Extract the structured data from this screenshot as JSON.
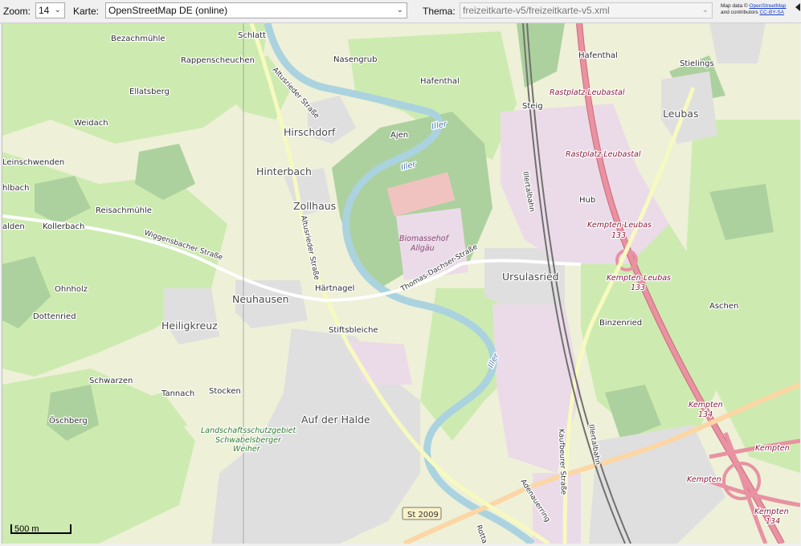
{
  "toolbar": {
    "zoom_label": "Zoom:",
    "zoom_value": "14",
    "map_label": "Karte:",
    "map_value": "OpenStreetMap DE (online)",
    "theme_label": "Thema:",
    "theme_value": "freizeitkarte-v5/freizeitkarte-v5.xml",
    "attribution_prefix": "Map data ©",
    "attribution_link": "OpenStreetMap",
    "attribution_mid": "and contributors",
    "attribution_license": "CC-BY-SA"
  },
  "map": {
    "scale_label": "500 m",
    "places_large": [
      "Hirschdorf",
      "Hinterbach",
      "Zollhaus",
      "Neuhausen",
      "Heiligkreuz",
      "Auf der Halde",
      "Ursulasried",
      "Leubas"
    ],
    "places_small": [
      "Schlatt",
      "Bezachmühle",
      "Rappenscheuchen",
      "Nasengrub",
      "Hafenthal",
      "Hafenthal",
      "Stielings",
      "Ellatsberg",
      "Weidach",
      "Steig",
      "Ajen",
      "Leinschwenden",
      "hlbach",
      "Reisachmühle",
      "alden",
      "Kollerbach",
      "Ohnholz",
      "Härtnagel",
      "Dottenried",
      "Stiftsbleiche",
      "Hub",
      "Binzenried",
      "Aschen",
      "Schwarzen",
      "Tannach",
      "Stocken",
      "Öschberg"
    ],
    "streets": [
      "Altusrieder Straße",
      "Altusrieder Straße",
      "Wiggensbacher Straße",
      "Thomas-Dachser-Straße",
      "Illertalbahn",
      "Illertalbahn",
      "Kaufbeurer Straße",
      "Adenauerring",
      "Rotta"
    ],
    "water": [
      "Iller",
      "Iller",
      "Iller"
    ],
    "pois": [
      "Rastplatz Leubastal",
      "Rastplatz Leubastal",
      "Kempten-Leubas",
      "133",
      "Kempten-Leubas",
      "133",
      "Kempten",
      "134",
      "Kempten",
      "Kempten",
      "Kempten",
      "134"
    ],
    "areas": [
      "Biomassehof",
      "Allgäu",
      "Landschaftsschutzgebiet",
      "Schwabelsberger",
      "Weiher"
    ],
    "road_shield": "St 2009"
  },
  "colors": {
    "landscape": "#eef0d8",
    "meadow": "#cdebb0",
    "forest": "#add19e",
    "residential": "#e0dfdf",
    "industrial": "#ebdbe8",
    "water": "#aad3df",
    "motorway": "#e892a2",
    "primary": "#fcd6a4",
    "secondary": "#f7fabf",
    "rail": "#707070"
  }
}
